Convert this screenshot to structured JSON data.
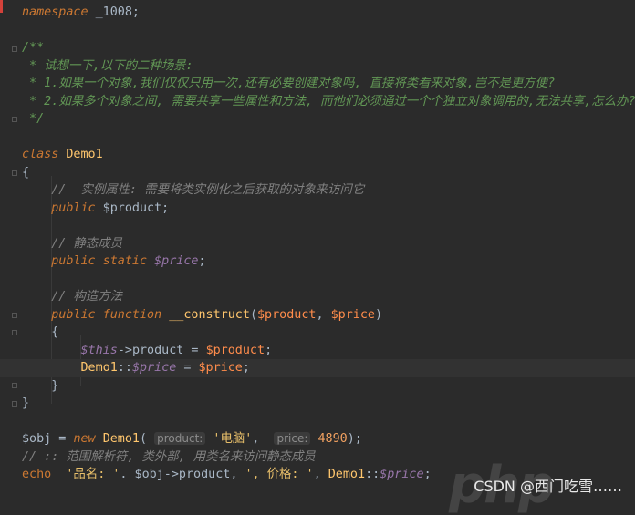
{
  "editor": {
    "lines": [
      [
        {
          "t": "namespace",
          "c": "kw"
        },
        {
          "t": " _1008;",
          "c": "plain"
        }
      ],
      [],
      [
        {
          "t": "/**",
          "c": "doc"
        }
      ],
      [
        {
          "t": " * 试想一下,以下的二种场景:",
          "c": "doc"
        }
      ],
      [
        {
          "t": " * 1.如果一个对象,我们仅仅只用一次,还有必要创建对象吗, 直接将类看来对象,岂不是更方便?",
          "c": "doc"
        }
      ],
      [
        {
          "t": " * 2.如果多个对象之间, 需要共享一些属性和方法, 而他们必须通过一个个独立对象调用的,无法共享,怎么办?",
          "c": "doc"
        }
      ],
      [
        {
          "t": " */",
          "c": "doc"
        }
      ],
      [],
      [
        {
          "t": "class",
          "c": "kw"
        },
        {
          "t": " ",
          "c": "plain"
        },
        {
          "t": "Demo1",
          "c": "cls"
        }
      ],
      [
        {
          "t": "{",
          "c": "plain"
        }
      ],
      [
        {
          "t": "    ",
          "c": "plain"
        },
        {
          "t": "//  实例属性: 需要将类实例化之后获取的对象来访问它",
          "c": "cmt"
        }
      ],
      [
        {
          "t": "    ",
          "c": "plain"
        },
        {
          "t": "public",
          "c": "kw"
        },
        {
          "t": " $product;",
          "c": "plain"
        }
      ],
      [],
      [
        {
          "t": "    ",
          "c": "plain"
        },
        {
          "t": "// 静态成员",
          "c": "cmt"
        }
      ],
      [
        {
          "t": "    ",
          "c": "plain"
        },
        {
          "t": "public",
          "c": "kw"
        },
        {
          "t": " ",
          "c": "plain"
        },
        {
          "t": "static",
          "c": "kw"
        },
        {
          "t": " ",
          "c": "plain"
        },
        {
          "t": "$price",
          "c": "var kw"
        },
        {
          "t": ";",
          "c": "plain"
        }
      ],
      [],
      [
        {
          "t": "    ",
          "c": "plain"
        },
        {
          "t": "// 构造方法",
          "c": "cmt"
        }
      ],
      [
        {
          "t": "    ",
          "c": "plain"
        },
        {
          "t": "public",
          "c": "kw"
        },
        {
          "t": " ",
          "c": "plain"
        },
        {
          "t": "function",
          "c": "kw"
        },
        {
          "t": " ",
          "c": "plain"
        },
        {
          "t": "__construct",
          "c": "fn"
        },
        {
          "t": "(",
          "c": "plain"
        },
        {
          "t": "$product",
          "c": "varp"
        },
        {
          "t": ", ",
          "c": "plain"
        },
        {
          "t": "$price",
          "c": "varp"
        },
        {
          "t": ")",
          "c": "plain"
        }
      ],
      [
        {
          "t": "    {",
          "c": "plain"
        }
      ],
      [
        {
          "t": "        ",
          "c": "plain"
        },
        {
          "t": "$this",
          "c": "var kw"
        },
        {
          "t": "->",
          "c": "plain"
        },
        {
          "t": "product",
          "c": "plain"
        },
        {
          "t": " = ",
          "c": "plain"
        },
        {
          "t": "$product",
          "c": "varp"
        },
        {
          "t": ";",
          "c": "plain"
        }
      ],
      [
        {
          "t": "        ",
          "c": "plain"
        },
        {
          "t": "Demo1",
          "c": "cls"
        },
        {
          "t": "::",
          "c": "plain"
        },
        {
          "t": "$price",
          "c": "var kw"
        },
        {
          "t": " = ",
          "c": "plain"
        },
        {
          "t": "$price",
          "c": "varp"
        },
        {
          "t": ";",
          "c": "plain"
        }
      ],
      [
        {
          "t": "    }",
          "c": "plain"
        }
      ],
      [
        {
          "t": "}",
          "c": "plain"
        }
      ],
      [],
      [
        {
          "t": "$obj = ",
          "c": "plain"
        },
        {
          "t": "new",
          "c": "kw"
        },
        {
          "t": " ",
          "c": "plain"
        },
        {
          "t": "Demo1",
          "c": "cls"
        },
        {
          "t": "( ",
          "c": "plain"
        },
        {
          "t": "product:",
          "c": "hint"
        },
        {
          "t": " ",
          "c": "plain"
        },
        {
          "t": "'电脑'",
          "c": "str hi"
        },
        {
          "t": ",  ",
          "c": "plain"
        },
        {
          "t": "price:",
          "c": "hint"
        },
        {
          "t": " ",
          "c": "plain"
        },
        {
          "t": "4890",
          "c": "num hi"
        },
        {
          "t": ");",
          "c": "plain"
        }
      ],
      [
        {
          "t": "// :: 范围解析符, 类外部, 用类名来访问静态成员",
          "c": "cmt"
        }
      ],
      [
        {
          "t": "echo",
          "c": "kwn"
        },
        {
          "t": "  ",
          "c": "plain"
        },
        {
          "t": "'品名: '",
          "c": "str hi"
        },
        {
          "t": ". $obj->product, ",
          "c": "plain"
        },
        {
          "t": "', 价格: '",
          "c": "str hi"
        },
        {
          "t": ", ",
          "c": "plain"
        },
        {
          "t": "Demo1",
          "c": "cls"
        },
        {
          "t": "::",
          "c": "plain"
        },
        {
          "t": "$price",
          "c": "var kw"
        },
        {
          "t": ";",
          "c": "plain"
        }
      ]
    ],
    "current_line": 20
  },
  "watermark": {
    "text": "CSDN @西门吃雪……"
  }
}
